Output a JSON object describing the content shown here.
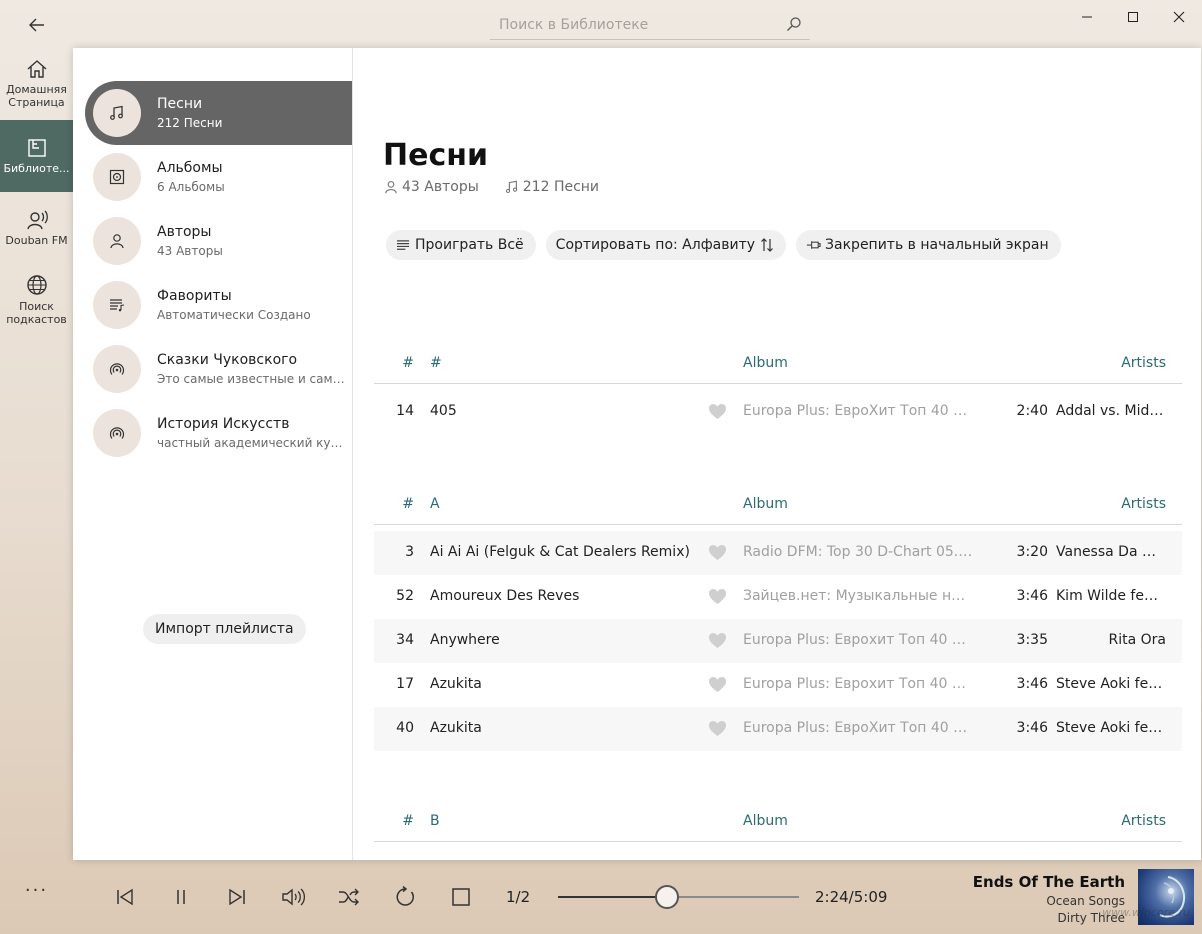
{
  "titlebar": {
    "search_placeholder": "Поиск в Библиотеке"
  },
  "rail": {
    "items": [
      {
        "label": "Домашняя Страница",
        "icon": "home-icon"
      },
      {
        "label": "Библиоте...",
        "icon": "library-icon",
        "active": true
      },
      {
        "label": "Douban FM",
        "icon": "radio-icon"
      },
      {
        "label": "Поиск подкастов",
        "icon": "globe-icon"
      }
    ],
    "more": "..."
  },
  "library_nav": {
    "items": [
      {
        "title": "Песни",
        "subtitle": "212 Песни",
        "icon": "music-note-icon",
        "active": true
      },
      {
        "title": "Альбомы",
        "subtitle": "6 Альбомы",
        "icon": "album-icon"
      },
      {
        "title": "Авторы",
        "subtitle": "43 Авторы",
        "icon": "person-icon"
      },
      {
        "title": "Фавориты",
        "subtitle": "Автоматически Создано",
        "icon": "playlist-icon"
      },
      {
        "title": "Сказки Чуковского",
        "subtitle": "Это самые известные и самые любимые сказки",
        "icon": "podcast-icon"
      },
      {
        "title": "История Искусств",
        "subtitle": "частный академический курс истории искусств",
        "icon": "podcast-icon"
      }
    ],
    "import_label": "Импорт плейлиста"
  },
  "main": {
    "title": "Песни",
    "artists_count": "43 Авторы",
    "songs_count": "212 Песни",
    "actions": {
      "play_all": "Проиграть Всё",
      "sort": "Сортировать по:  Алфавиту",
      "pin": "Закрепить в начальный экран"
    },
    "columns": {
      "num": "#",
      "album": "Album",
      "artists": "Artists"
    },
    "groups": [
      {
        "letter": "#",
        "rows": [
          {
            "num": "14",
            "title": "405",
            "album": "Europa Plus: ЕвроХит Топ 40 10...",
            "duration": "2:40",
            "artist": "Addal vs. Mida..."
          }
        ]
      },
      {
        "letter": "A",
        "rows": [
          {
            "num": "3",
            "title": "Ai Ai Ai (Felguk & Cat Dealers Remix)",
            "album": "Radio DFM: Top 30 D-Chart 05.1...",
            "duration": "3:20",
            "artist": "Vanessa Da M..."
          },
          {
            "num": "52",
            "title": "Amoureux Des Reves",
            "album": "Зайцев.нет: Музыкальные нов...",
            "duration": "3:46",
            "artist": "Kim Wilde feat..."
          },
          {
            "num": "34",
            "title": "Anywhere",
            "album": "Europa Plus: Еврохит Топ 40 18....",
            "duration": "3:35",
            "artist": "Rita Ora"
          },
          {
            "num": "17",
            "title": "Azukita",
            "album": "Europa Plus: Еврохит Топ 40 18....",
            "duration": "3:46",
            "artist": "Steve Aoki feat..."
          },
          {
            "num": "40",
            "title": "Azukita",
            "album": "Europa Plus: ЕвроХит Топ 40 10....",
            "duration": "3:46",
            "artist": "Steve Aoki feat..."
          }
        ]
      },
      {
        "letter": "B",
        "rows": []
      }
    ]
  },
  "player": {
    "queue": "1/2",
    "progress_fraction": 0.453,
    "time": "2:24/5:09",
    "now_playing": {
      "title": "Ends Of The Earth",
      "album": "Ocean Songs",
      "artist": "Dirty Three"
    },
    "watermark": "www.wincore.ru"
  }
}
